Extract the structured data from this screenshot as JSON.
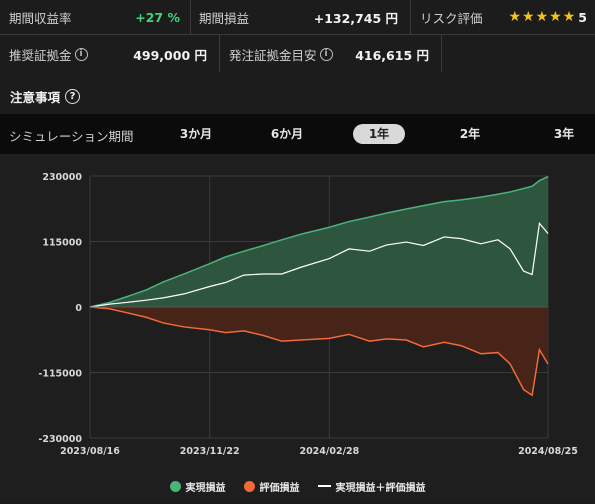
{
  "stats": {
    "period_return_label": "期間収益率",
    "period_return_value": "+27 %",
    "period_pnl_label": "期間損益",
    "period_pnl_value": "+132,745 円",
    "risk_label": "リスク評価",
    "risk_value": "5",
    "recommended_margin_label": "推奨証拠金",
    "recommended_margin_value": "499,000 円",
    "order_margin_label": "発注証拠金目安",
    "order_margin_value": "416,615 円"
  },
  "notes_label": "注意事項",
  "period": {
    "label": "シミュレーション期間",
    "tabs": [
      "3か月",
      "6か月",
      "1年",
      "2年",
      "3年"
    ],
    "active": "1年"
  },
  "colors": {
    "realized": "#4bb27a",
    "unrealized": "#f26a3a",
    "total": "#ffffff",
    "accent_green": "#3fd67a",
    "star": "#f4c21b"
  },
  "chart_data": {
    "type": "area",
    "ylim": [
      -230000,
      230000
    ],
    "y_ticks": [
      230000,
      115000,
      0,
      -115000,
      -230000
    ],
    "y_tick_labels": [
      "230000",
      "115000",
      "0",
      "-115000",
      "-230000"
    ],
    "x_ticks": [
      "2023/08/16",
      "2023/11/22",
      "2024/02/28",
      "2024/08/25"
    ],
    "x": [
      "2023/08/16",
      "2023/09/01",
      "2023/09/15",
      "2023/10/01",
      "2023/10/15",
      "2023/11/01",
      "2023/11/22",
      "2023/12/05",
      "2023/12/20",
      "2024/01/05",
      "2024/01/20",
      "2024/02/05",
      "2024/02/28",
      "2024/03/15",
      "2024/04/01",
      "2024/04/15",
      "2024/05/01",
      "2024/05/15",
      "2024/06/01",
      "2024/06/15",
      "2024/07/01",
      "2024/07/15",
      "2024/07/25",
      "2024/08/05",
      "2024/08/12",
      "2024/08/18",
      "2024/08/25"
    ],
    "series": [
      {
        "name": "実現損益",
        "values": [
          0,
          8000,
          18000,
          30000,
          44000,
          58000,
          76000,
          88000,
          98000,
          108000,
          118000,
          128000,
          140000,
          150000,
          158000,
          165000,
          172000,
          178000,
          185000,
          188000,
          193000,
          198000,
          202000,
          208000,
          212000,
          222000,
          229000
        ]
      },
      {
        "name": "評価損益",
        "values": [
          0,
          -3000,
          -10000,
          -18000,
          -28000,
          -35000,
          -40000,
          -45000,
          -42000,
          -50000,
          -60000,
          -58000,
          -55000,
          -48000,
          -60000,
          -56000,
          -58000,
          -70000,
          -62000,
          -68000,
          -82000,
          -80000,
          -100000,
          -145000,
          -155000,
          -75000,
          -100000
        ]
      },
      {
        "name": "実現損益＋評価損益",
        "values": [
          0,
          5000,
          8000,
          12000,
          16000,
          23000,
          36000,
          43000,
          56000,
          58000,
          58000,
          70000,
          85000,
          102000,
          98000,
          109000,
          114000,
          108000,
          123000,
          120000,
          111000,
          118000,
          102000,
          63000,
          57000,
          147000,
          129000
        ]
      }
    ]
  }
}
